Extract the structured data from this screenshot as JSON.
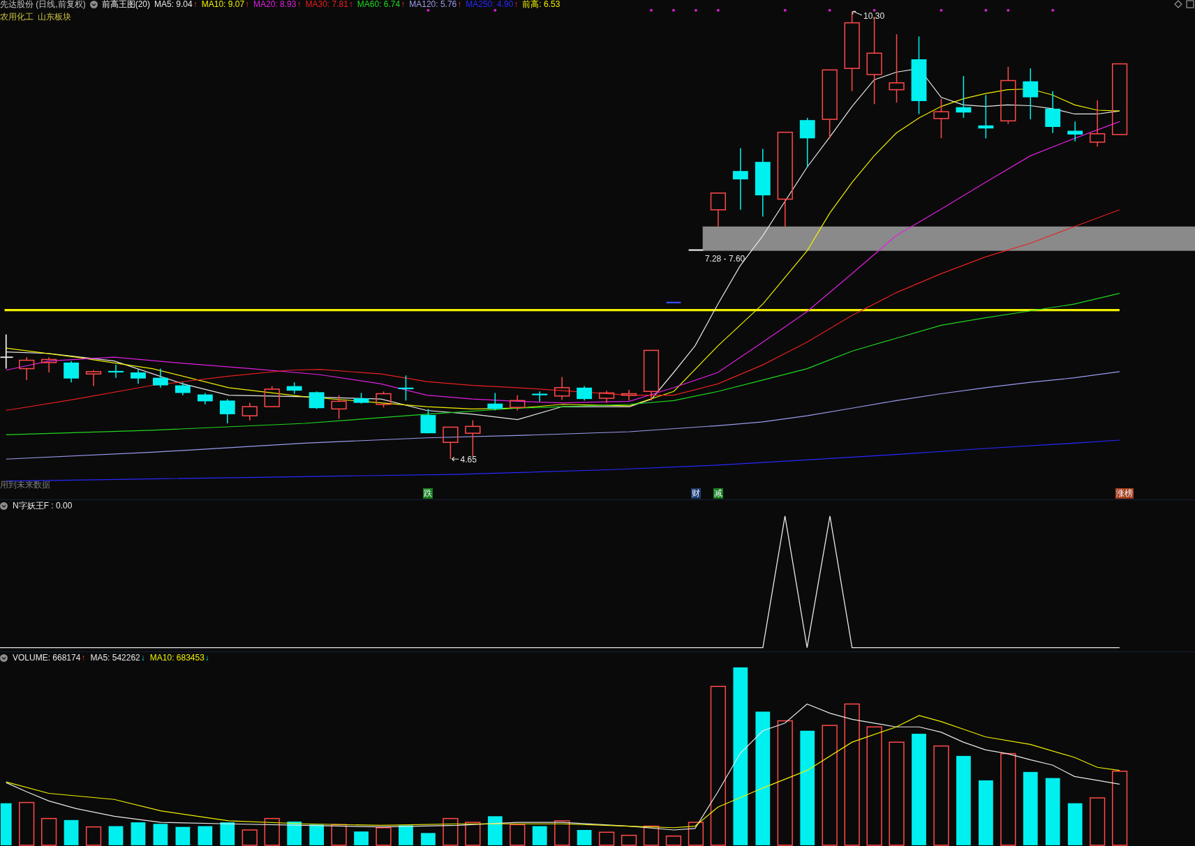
{
  "main_panel": {
    "title": "先达股份 (日线,前复权)",
    "indicator": "前高王图(20)",
    "values": [
      {
        "label": "MA5: 9.04",
        "color": "#e8e8e8",
        "arrow": "↑",
        "rising": true
      },
      {
        "label": "MA10: 9.07",
        "color": "#f0f000",
        "arrow": "↑",
        "rising": true
      },
      {
        "label": "MA20: 8.93",
        "color": "#e020e0",
        "arrow": "↑",
        "rising": true
      },
      {
        "label": "MA30: 7.81",
        "color": "#e82020",
        "arrow": "↑",
        "rising": true
      },
      {
        "label": "MA60: 6.74",
        "color": "#20d820",
        "arrow": "↑",
        "rising": true
      },
      {
        "label": "MA120: 5.76",
        "color": "#9c9cf0",
        "arrow": "↑",
        "rising": true
      },
      {
        "label": "MA250: 4.90",
        "color": "#2828ff",
        "arrow": "↑",
        "rising": true
      },
      {
        "label": "前高: 6.53",
        "color": "#f0f000"
      }
    ],
    "sectors": [
      "农用化工",
      "山东板块"
    ],
    "annotations": [
      {
        "kind": "high",
        "text": "10.30"
      },
      {
        "kind": "range",
        "text": "7.28 - 7.60"
      },
      {
        "kind": "low",
        "text": "4.65"
      }
    ],
    "notice": "用到未来数据",
    "signals": [
      {
        "text": "跌",
        "color": "#17801a"
      },
      {
        "text": "财",
        "color": "#1c3a6e"
      },
      {
        "text": "减",
        "color": "#17801a"
      },
      {
        "text": "涨榜",
        "color": "#a8401c"
      }
    ]
  },
  "indicator_panel": {
    "label": "N字妖王F : 0.00"
  },
  "volume_panel": {
    "values": [
      {
        "label": "VOLUME: 668174",
        "color": "#e8e8e8",
        "arrow": "↑",
        "rising": true
      },
      {
        "label": "MA5: 542262",
        "color": "#e8e8e8",
        "arrow": "↓",
        "rising": false
      },
      {
        "label": "MA10: 683453",
        "color": "#f0f000",
        "arrow": "↓",
        "rising": false
      }
    ]
  }
}
